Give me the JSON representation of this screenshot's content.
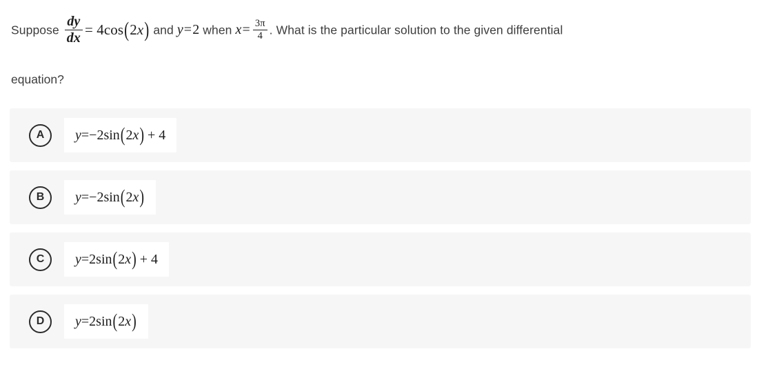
{
  "question": {
    "prefix": "Suppose",
    "derivative": {
      "numerator": "dy",
      "denominator": "dx"
    },
    "equals_rhs": "= 4cos",
    "rhs_arg": "2x",
    "mid_1": "and",
    "initial_condition": "y = 2",
    "mid_2": "when",
    "x_equals": "x =",
    "x_value": {
      "numerator": "3π",
      "denominator": "4"
    },
    "period": ".",
    "tail": "What is the particular solution to the given differential",
    "line2": "equation?"
  },
  "options": [
    {
      "letter": "A",
      "lhs": "y",
      "eq": "=",
      "sign": "−",
      "coefficient": "2sin",
      "arg": "2x",
      "constant": "+ 4",
      "text": "y = − 2sin(2x) + 4"
    },
    {
      "letter": "B",
      "lhs": "y",
      "eq": "=",
      "sign": "−",
      "coefficient": "2sin",
      "arg": "2x",
      "constant": "",
      "text": "y = − 2sin(2x)"
    },
    {
      "letter": "C",
      "lhs": "y",
      "eq": "=",
      "sign": "",
      "coefficient": "2sin",
      "arg": "2x",
      "constant": "+ 4",
      "text": "y = 2sin(2x) + 4"
    },
    {
      "letter": "D",
      "lhs": "y",
      "eq": "=",
      "sign": "",
      "coefficient": "2sin",
      "arg": "2x",
      "constant": "",
      "text": "y = 2sin(2x)"
    }
  ],
  "colors": {
    "page_background": "#ffffff",
    "row_background": "#f6f6f7",
    "answer_box_background": "#ffffff",
    "prose_text": "#3d3d3d",
    "math_text": "#1d1d1d",
    "badge_border": "#2b2b2b"
  }
}
